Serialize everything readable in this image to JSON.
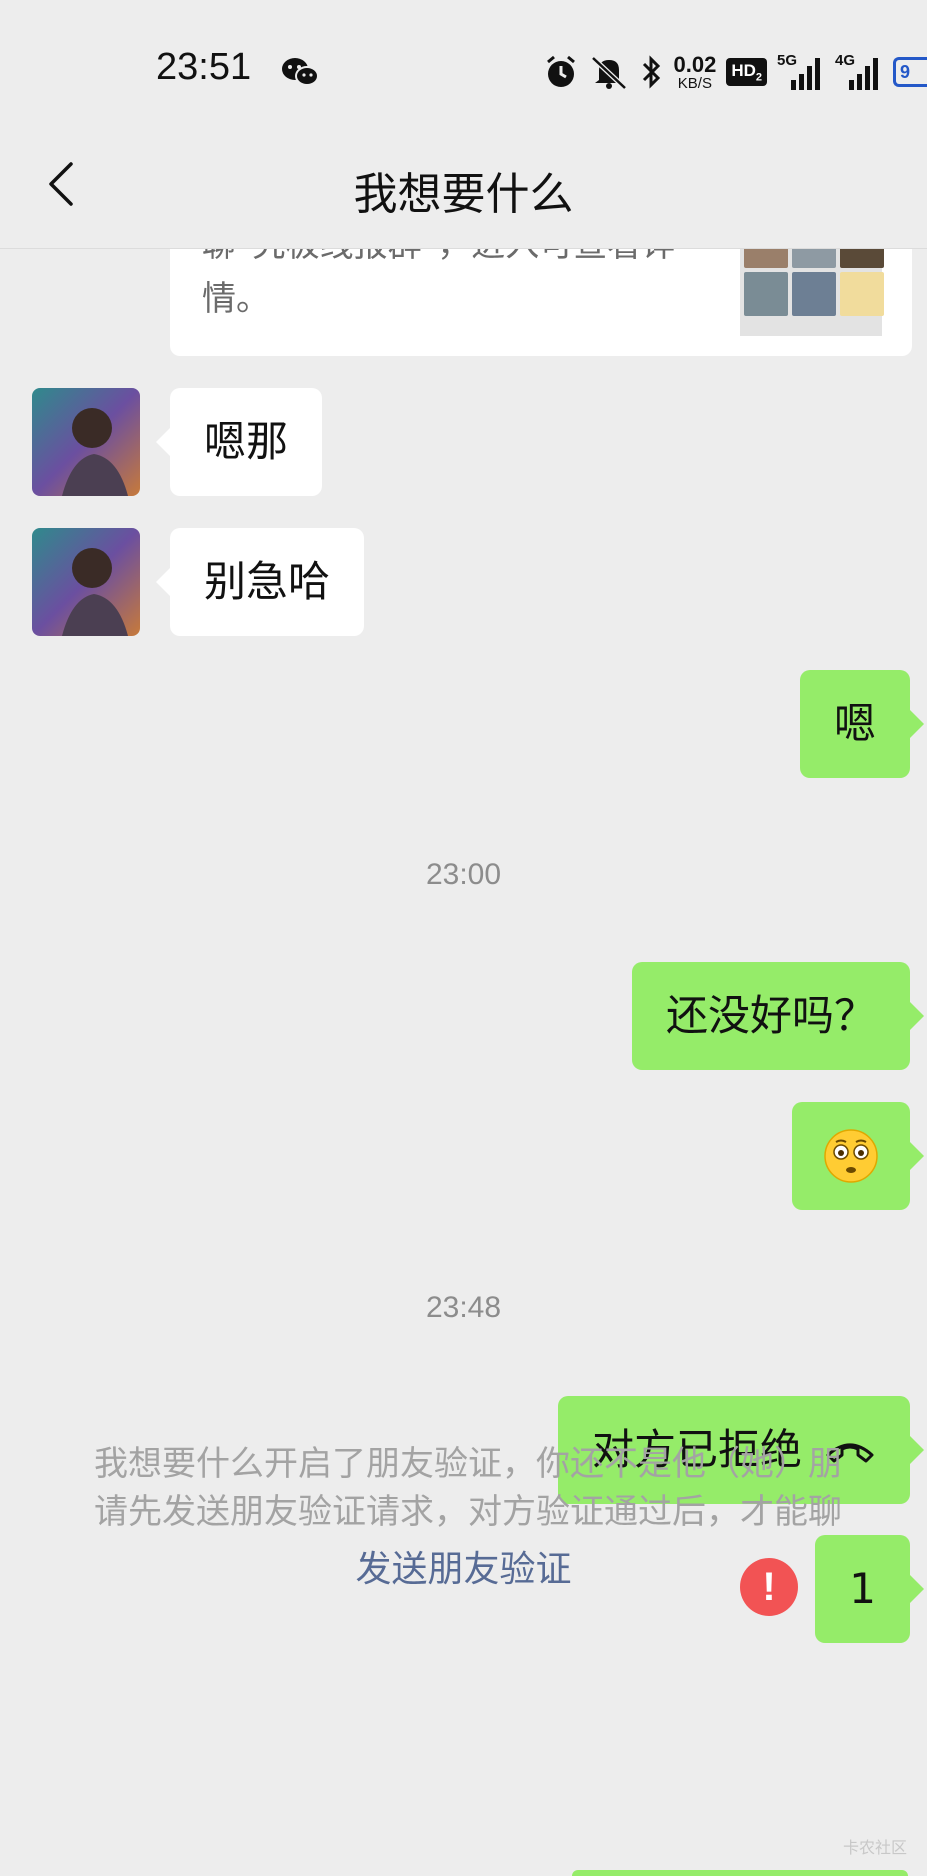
{
  "status_bar": {
    "time": "23:51",
    "net_speed_value": "0.02",
    "net_speed_unit": "KB/S",
    "hd_label": "HD",
    "hd_sub": "2",
    "sig1_label": "5G",
    "sig2_label": "4G",
    "battery_text": "9"
  },
  "header": {
    "title": "我想要什么"
  },
  "card": {
    "text": "聊\"究极线报群\"，进入可查看详情。"
  },
  "messages": [
    {
      "side": "in",
      "text": "嗯那"
    },
    {
      "side": "in",
      "text": "别急哈"
    },
    {
      "side": "out",
      "text": "嗯"
    },
    {
      "side": "out",
      "text": "还没好吗？"
    },
    {
      "side": "out",
      "emoji": "flushed-face"
    },
    {
      "side": "out",
      "text": "对方已拒绝",
      "icon": "call-declined-icon"
    },
    {
      "side": "out",
      "text": "1",
      "failed": true
    }
  ],
  "timestamps": [
    "23:00",
    "23:48"
  ],
  "error_glyph": "!",
  "system_notice": {
    "line1": "我想要什么开启了朋友验证，你还不是他（她）朋",
    "line2": "请先发送朋友验证请求，对方验证通过后，才能聊",
    "link": "发送朋友验证"
  },
  "watermark": "卡农社区",
  "colors": {
    "background": "#ededed",
    "bubble_out": "#95ec69",
    "bubble_in": "#ffffff",
    "link": "#576b95",
    "error": "#f25354"
  }
}
